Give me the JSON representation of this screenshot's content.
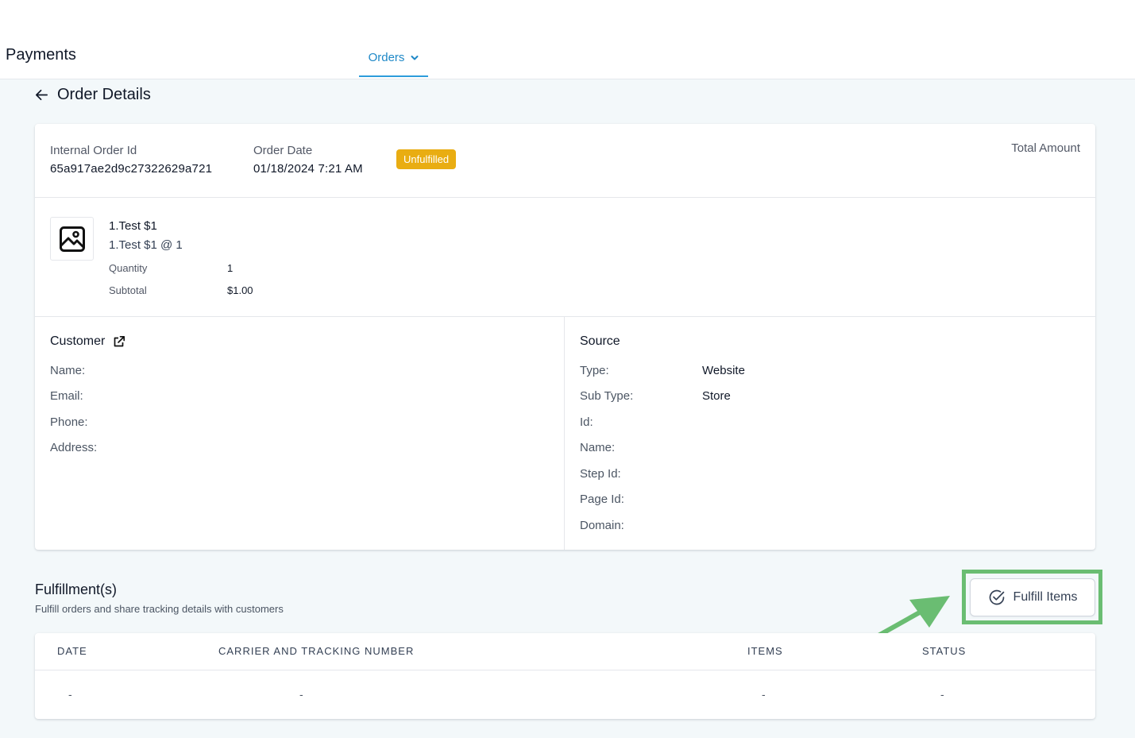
{
  "topbar": {
    "app_title": "Payments",
    "nav_tab": "Orders"
  },
  "page": {
    "title": "Order Details"
  },
  "order": {
    "internal_id_label": "Internal Order Id",
    "internal_id": "65a917ae2d9c27322629a721",
    "date_label": "Order Date",
    "date": "01/18/2024 7:21 AM",
    "status": "Unfulfilled",
    "status_color": "#e9ad12",
    "total_label": "Total Amount"
  },
  "item": {
    "name": "1.Test $1",
    "desc": "1.Test $1 @ 1",
    "quantity_label": "Quantity",
    "quantity": "1",
    "subtotal_label": "Subtotal",
    "subtotal": "$1.00",
    "thumb_icon": "image-placeholder-icon"
  },
  "customer": {
    "title": "Customer",
    "labels": [
      "Name:",
      "Email:",
      "Phone:",
      "Address:"
    ]
  },
  "source": {
    "title": "Source",
    "rows": [
      {
        "label": "Type:",
        "value": "Website"
      },
      {
        "label": "Sub Type:",
        "value": "Store"
      },
      {
        "label": "Id:",
        "value": ""
      },
      {
        "label": "Name:",
        "value": ""
      },
      {
        "label": "Step Id:",
        "value": ""
      },
      {
        "label": "Page Id:",
        "value": ""
      },
      {
        "label": "Domain:",
        "value": ""
      }
    ]
  },
  "fulfillments": {
    "title": "Fulfillment(s)",
    "subtitle": "Fulfill orders and share tracking details with customers",
    "button_label": "Fulfill Items",
    "highlight_color": "#6abd72",
    "columns": [
      "DATE",
      "CARRIER AND TRACKING NUMBER",
      "ITEMS",
      "STATUS"
    ],
    "rows": [
      [
        "-",
        "-",
        "-",
        "-"
      ]
    ]
  }
}
